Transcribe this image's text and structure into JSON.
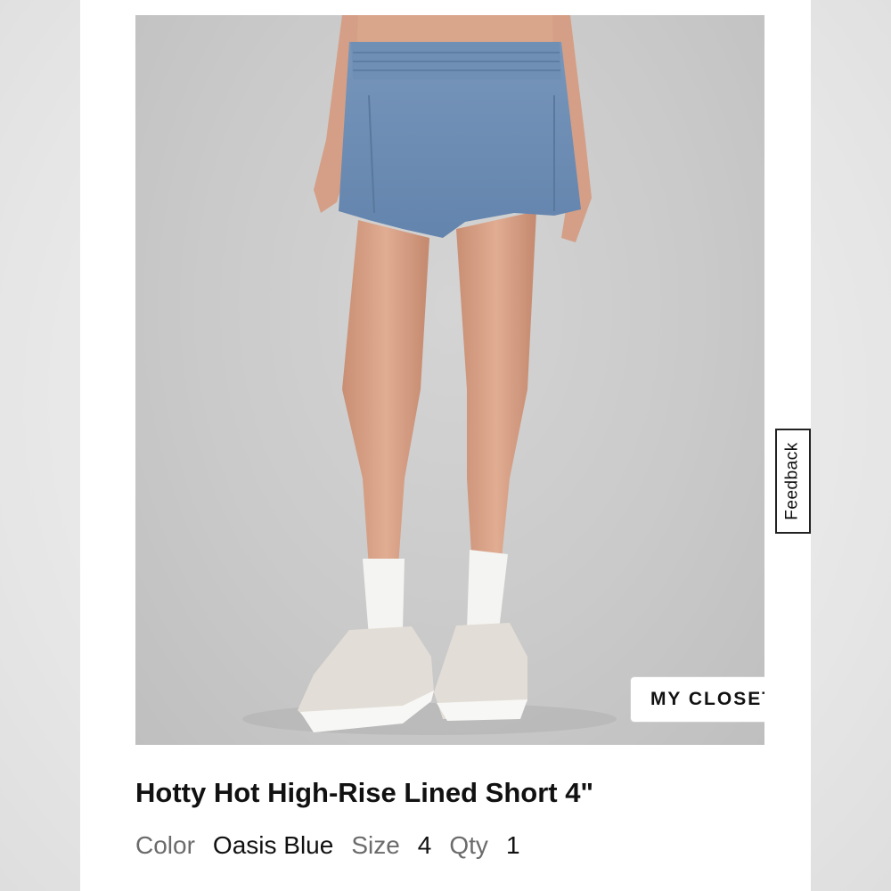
{
  "overlay": {
    "closet_label": "MY CLOSET",
    "feedback_label": "Feedback"
  },
  "product": {
    "title": "Hotty Hot High-Rise Lined Short 4\"",
    "image_alt": "Model wearing blue high-rise lined running shorts with white socks and light grey sneakers",
    "details": {
      "color_label": "Color",
      "color_value": "Oasis Blue",
      "size_label": "Size",
      "size_value": "4",
      "qty_label": "Qty",
      "qty_value": "1"
    }
  },
  "colors": {
    "shorts": "#6f8fb5",
    "background": "#cacaca",
    "skin": "#d8a48a"
  }
}
